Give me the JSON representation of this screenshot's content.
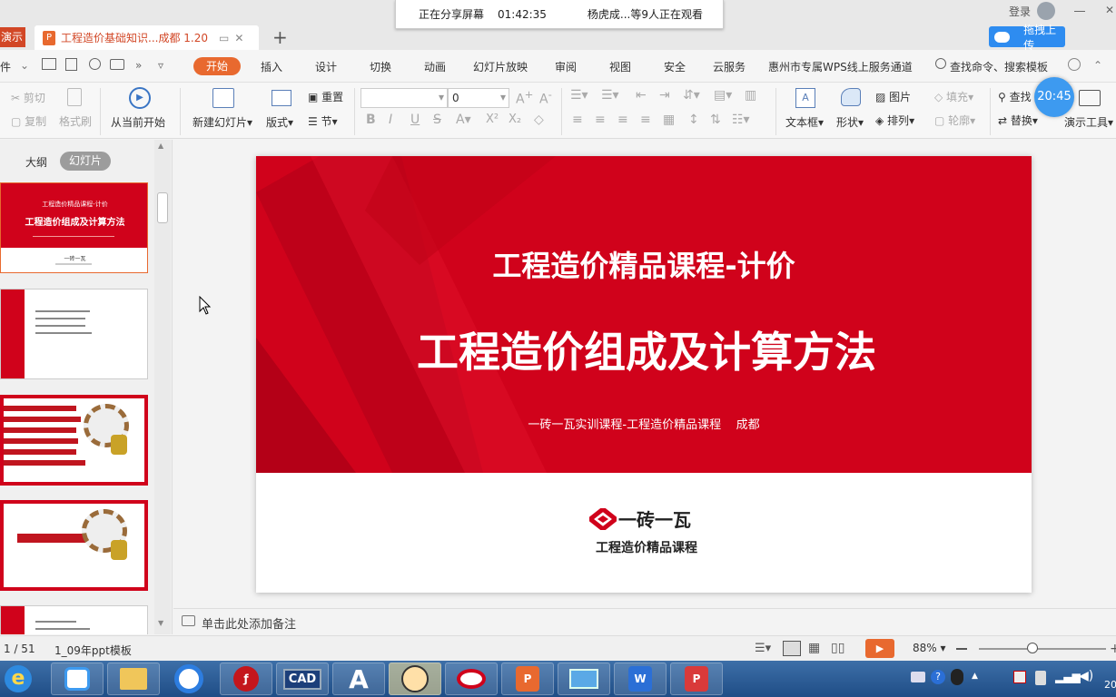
{
  "window": {
    "app_tab": "演示",
    "doc_tab_title": "工程造价基础知识...成都  1.20",
    "login": "登录",
    "upload_button": "拖拽上传"
  },
  "share_bar": {
    "status": "正在分享屏幕",
    "elapsed": "01:42:35",
    "viewers": "杨虎成...等9人正在观看"
  },
  "menu": {
    "file": "件",
    "items": [
      "开始",
      "插入",
      "设计",
      "切换",
      "动画",
      "幻灯片放映",
      "审阅",
      "视图",
      "安全",
      "云服务",
      "惠州市专属WPS线上服务通道"
    ],
    "search_placeholder": "查找命令、搜索模板"
  },
  "ribbon": {
    "cut": "剪切",
    "copy": "复制",
    "format_painter": "格式刷",
    "from_current": "从当前开始",
    "new_slide": "新建幻灯片",
    "layout": "版式",
    "reset": "重置",
    "section": "节",
    "font_size": "0",
    "textbox": "文本框",
    "shape": "形状",
    "picture": "图片",
    "arrange": "排列",
    "fill": "填充",
    "outline": "轮廓",
    "find": "查找",
    "replace": "替换",
    "present_tools": "演示工具",
    "clock": "20:45"
  },
  "left_panel": {
    "tab_outline": "大纲",
    "tab_slides": "幻灯片",
    "thumb1_line1": "工程造价精品课程-计价",
    "thumb1_line2": "工程造价组成及计算方法",
    "thumb_logo": "一砖一瓦"
  },
  "slide": {
    "title_top": "工程造价精品课程-计价",
    "title_main": "工程造价组成及计算方法",
    "subtitle": "一砖一瓦实训课程-工程造价精品课程    成都",
    "logo_text": "一砖一瓦",
    "logo_sub": "工程造价精品课程"
  },
  "notes": {
    "placeholder": "单击此处添加备注"
  },
  "status": {
    "page": "1 / 51",
    "template": "1_09年ppt模板",
    "zoom": "88%"
  },
  "taskbar": {
    "cad_label": "CAD",
    "tray_year": "20"
  },
  "colors": {
    "accent_red": "#d0021b",
    "wps_orange": "#e8692f",
    "taskbar_blue": "#2a5c96"
  }
}
